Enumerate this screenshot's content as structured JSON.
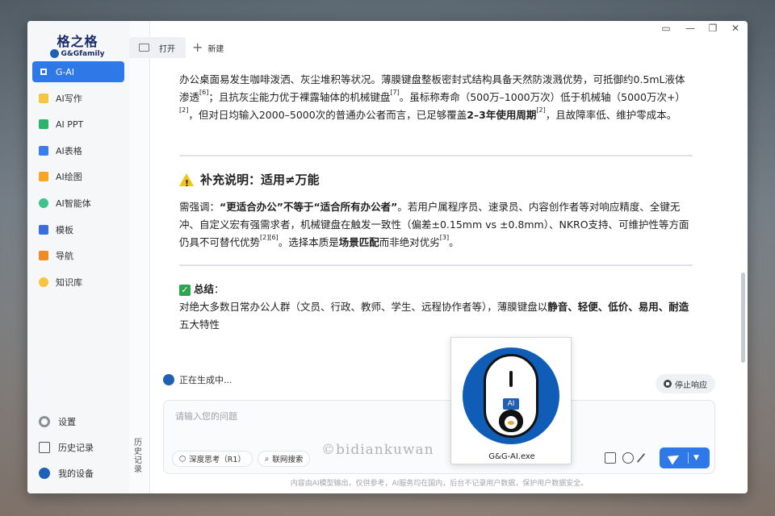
{
  "logo": {
    "title": "格之格",
    "subtitle": "G&Gfamily"
  },
  "sidebar": {
    "items": [
      {
        "label": "G-AI",
        "color": "#ffffff",
        "active": true
      },
      {
        "label": "AI写作",
        "color": "#f5c542"
      },
      {
        "label": "AI PPT",
        "color": "#2db36b"
      },
      {
        "label": "AI表格",
        "color": "#3a7de8"
      },
      {
        "label": "AI绘图",
        "color": "#f5a623"
      },
      {
        "label": "AI智能体",
        "color": "#3cc48a"
      },
      {
        "label": "模板",
        "color": "#3a6fd8"
      },
      {
        "label": "导航",
        "color": "#f08a24"
      },
      {
        "label": "知识库",
        "color": "#f5c542"
      }
    ],
    "bottom": [
      {
        "label": "设置"
      },
      {
        "label": "历史记录"
      },
      {
        "label": "我的设备"
      }
    ],
    "history_vertical": "历史记录"
  },
  "tabs": {
    "open": "打开",
    "new": "新建"
  },
  "window_controls": {
    "feedback": "▭",
    "minimize": "—",
    "restore": "❐",
    "close": "✕"
  },
  "content": {
    "p1_a": "办公桌面易发生咖啡泼洒、灰尘堆积等状况。薄膜键盘整板密封式结构具备天然防泼溅优势，可抵御约0.5mL液体渗透",
    "p1_ref1": "[6]",
    "p1_b": "；且抗灰尘能力优于裸露轴体的机械键盘",
    "p1_ref2": "[7]",
    "p1_c": "。虽标称寿命（500万–1000万次）低于机械轴（5000万次+）",
    "p1_ref3": "[2]",
    "p1_d": "，但对日均输入2000–5000次的普通办公者而言，已足够覆盖",
    "p1_bold": "2–3年使用周期",
    "p1_ref4": "[2]",
    "p1_e": "，且故障率低、维护零成本。",
    "h_supplement": "补充说明：适用≠万能",
    "p2_a": "需强调：",
    "p2_bold1": "“更适合办公”不等于“适合所有办公者”",
    "p2_b": "。若用户属程序员、速录员、内容创作者等对响应精度、全键无冲、自定义宏有强需求者，机械键盘在触发一致性（偏差±0.15mm vs ±0.8mm）、NKRO支持、可维护性等方面仍具不可替代优势",
    "p2_ref": "[2][6]",
    "p2_c": "。选择本质是",
    "p2_bold2": "场景匹配",
    "p2_d": "而非绝对优劣",
    "p2_ref2": "[3]",
    "p2_e": "。",
    "summary_title": "总结",
    "summary_colon": "：",
    "p3_a": "对绝大多数日常办公人群（文员、行政、教师、学生、远程协作者等），薄膜键盘以",
    "p3_bold": "静音、轻便、低价、易用、耐造",
    "p3_b": "五大特性"
  },
  "status": {
    "generating": "正在生成中...",
    "stop": "停止响应"
  },
  "input": {
    "placeholder": "请输入您的问题",
    "deep_think": "深度思考（R1）",
    "web_search": "联网搜索"
  },
  "disclaimer": "内容由AI模型输出，仅供参考，AI服务均在国内，后台不记录用户数据，保护用户数据安全。",
  "overlay": {
    "ai_badge": "AI",
    "label": "G&G-AI.exe"
  },
  "watermark": "©bidiankuwan",
  "colors": {
    "accent": "#2f78e8",
    "brand": "#1a2b6c"
  }
}
